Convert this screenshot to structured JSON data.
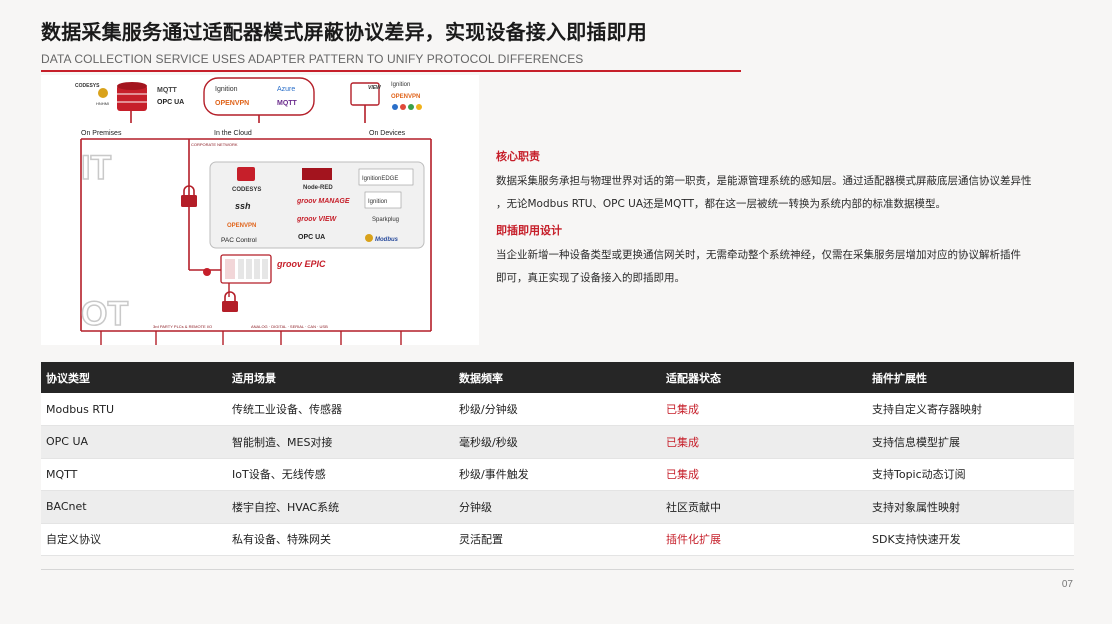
{
  "header": {
    "title": "数据采集服务通过适配器模式屏蔽协议差异，实现设备接入即插即用",
    "subtitle": "DATA COLLECTION SERVICE USES ADAPTER PATTERN TO UNIFY PROTOCOL DIFFERENCES"
  },
  "diagram": {
    "zones": [
      "On Premises",
      "In the Cloud",
      "On Devices"
    ],
    "network_label": "CORPORATE NETWORK",
    "layer_it": "IT",
    "layer_ot": "OT",
    "bottom_left_label": "3rd PARTY PLCs & REMOTE I/O",
    "bottom_right_label": "ANALOG · DIGITAL · SERIAL · CAN · USB",
    "top_left_logos": [
      "CODESYS",
      "MQTT",
      "OPC UA",
      "HNHMI"
    ],
    "top_mid_logos": [
      "Ignition",
      "Azure",
      "OPENVPN",
      "MQTT"
    ],
    "top_right_logos": [
      "Ignition",
      "OPENVPN"
    ],
    "top_right_product": "VIEW",
    "panel_logos": [
      "CODESYS",
      "Node-RED",
      "IgnitionEDGE",
      "ssh",
      "groov MANAGE",
      "Ignition",
      "OPENVPN",
      "groov VIEW",
      "Sparkplug",
      "PAC Control",
      "OPC UA",
      "Modbus"
    ],
    "controller_label": "groov EPIC"
  },
  "sections": [
    {
      "heading": "核心职责",
      "lines": [
        "数据采集服务承担与物理世界对话的第一职责，是能源管理系统的感知层。通过适配器模式屏蔽底层通信协议差异性",
        "，无论Modbus RTU、OPC UA还是MQTT，都在这一层被统一转换为系统内部的标准数据模型。"
      ]
    },
    {
      "heading": "即插即用设计",
      "lines": [
        "当企业新增一种设备类型或更换通信网关时，无需牵动整个系统神经，仅需在采集服务层增加对应的协议解析插件",
        "即可，真正实现了设备接入的即插即用。"
      ]
    }
  ],
  "table": {
    "columns": [
      "协议类型",
      "适用场景",
      "数据频率",
      "适配器状态",
      "插件扩展性"
    ],
    "rows": [
      [
        "Modbus RTU",
        "传统工业设备、传感器",
        "秒级/分钟级",
        "已集成",
        "支持自定义寄存器映射"
      ],
      [
        "OPC UA",
        "智能制造、MES对接",
        "毫秒级/秒级",
        "已集成",
        "支持信息模型扩展"
      ],
      [
        "MQTT",
        "IoT设备、无线传感",
        "秒级/事件触发",
        "已集成",
        "支持Topic动态订阅"
      ],
      [
        "BACnet",
        "楼宇自控、HVAC系统",
        "分钟级",
        "社区贡献中",
        "支持对象属性映射"
      ],
      [
        "自定义协议",
        "私有设备、特殊网关",
        "灵活配置",
        "插件化扩展",
        "SDK支持快速开发"
      ]
    ],
    "status_colors": {
      "已集成": "#c61f2a",
      "插件化扩展": "#c61f2a",
      "社区贡献中": "#222222"
    }
  },
  "footer": {
    "page_number": "07"
  },
  "colors": {
    "accent": "#c61f2a",
    "header_bg": "#262626"
  }
}
